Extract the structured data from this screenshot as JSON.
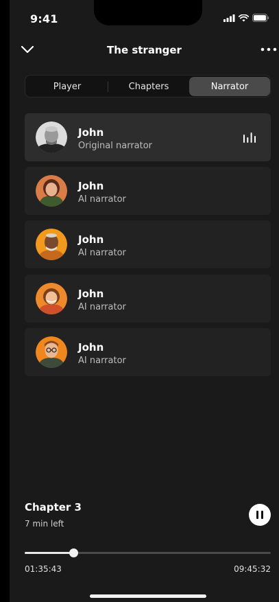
{
  "status_bar": {
    "time": "9:41"
  },
  "header": {
    "title": "The stranger"
  },
  "tabs": [
    {
      "label": "Player"
    },
    {
      "label": "Chapters"
    },
    {
      "label": "Narrator"
    }
  ],
  "selected_tab": "Narrator",
  "narrators": [
    {
      "name": "John",
      "subtitle": "Original narrator",
      "avatar": "portrait-grayscale-man",
      "selected": true
    },
    {
      "name": "John",
      "subtitle": "AI narrator",
      "avatar": "portrait-woman-brown-hair",
      "selected": false
    },
    {
      "name": "John",
      "subtitle": "AI narrator",
      "avatar": "portrait-older-man",
      "selected": false
    },
    {
      "name": "John",
      "subtitle": "AI narrator",
      "avatar": "portrait-woman-smiling",
      "selected": false
    },
    {
      "name": "John",
      "subtitle": "AI narrator",
      "avatar": "portrait-man-glasses",
      "selected": false
    }
  ],
  "now_playing": {
    "chapter": "Chapter 3",
    "time_left": "7 min left",
    "elapsed": "01:35:43",
    "total": "09:45:32",
    "progress_percent": 20
  },
  "colors": {
    "background": "#1a1a1a",
    "card": "#222222",
    "card_active": "#2d2d2d",
    "segment_active": "#4a4a4a",
    "avatar_orange": "#f08a1c"
  }
}
